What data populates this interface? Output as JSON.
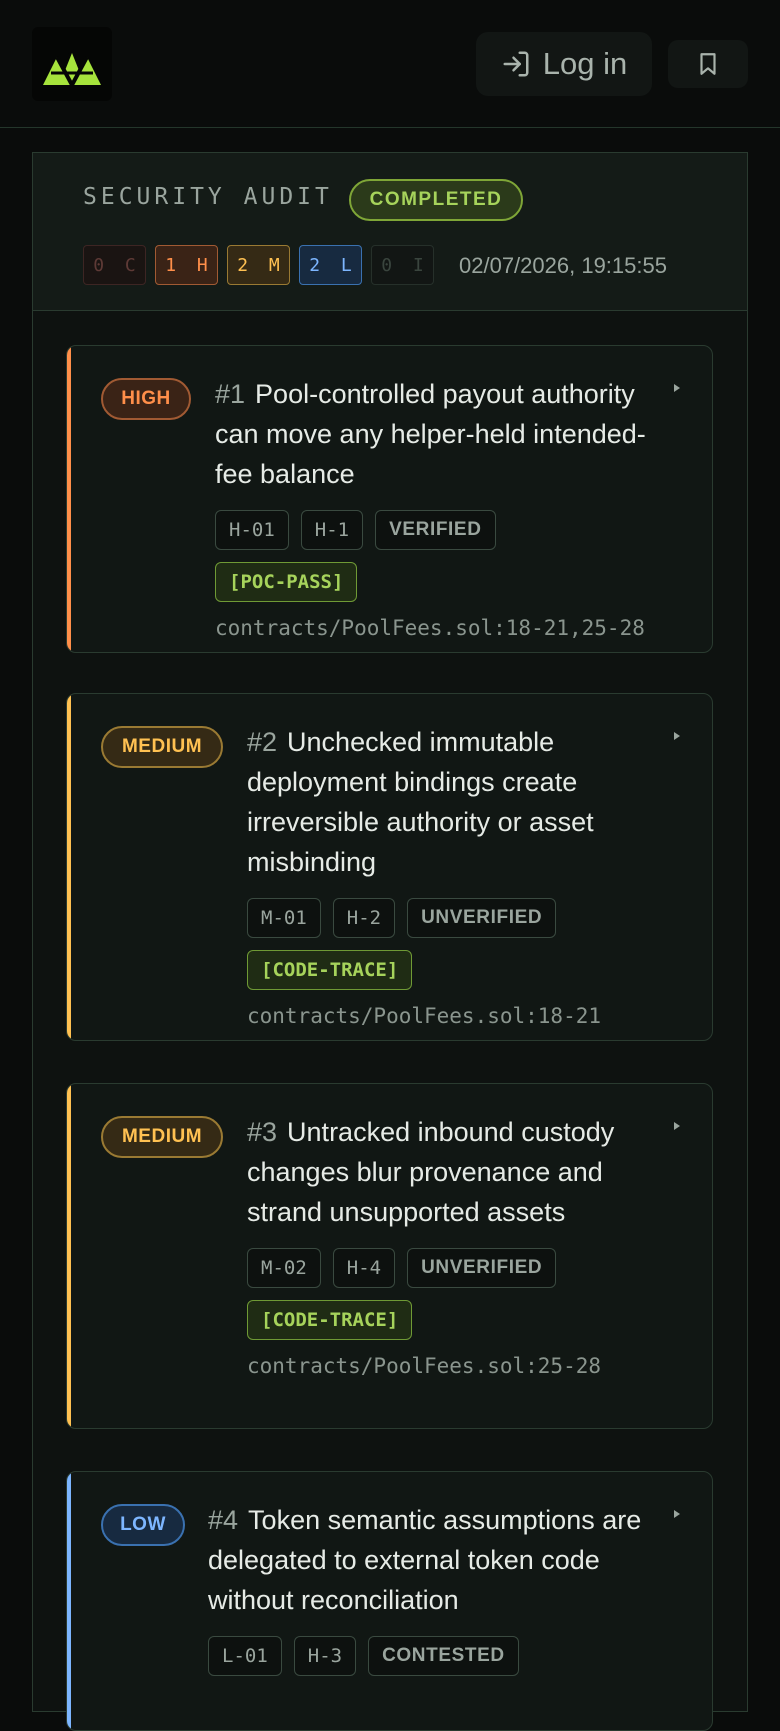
{
  "header": {
    "login_label": "Log in"
  },
  "audit": {
    "title": "SECURITY AUDIT",
    "status": "COMPLETED",
    "counts": [
      {
        "label": "0 C",
        "key": "critical"
      },
      {
        "label": "1 H",
        "key": "high"
      },
      {
        "label": "2 M",
        "key": "medium"
      },
      {
        "label": "2 L",
        "key": "low"
      },
      {
        "label": "0 I",
        "key": "info"
      }
    ],
    "timestamp": "02/07/2026, 19:15:55"
  },
  "colors": {
    "high": "#ff8f4a",
    "medium": "#ffc152",
    "low": "#7db6ff",
    "accent": "#a6d35b"
  },
  "findings": [
    {
      "severity": "HIGH",
      "number": "#1",
      "title": "Pool-controlled payout authority can move any helper-held intended-fee balance",
      "tags": [
        "H-01",
        "H-1",
        "VERIFIED"
      ],
      "method": "[POC-PASS]",
      "location": "contracts/PoolFees.sol:18-21,25-28"
    },
    {
      "severity": "MEDIUM",
      "number": "#2",
      "title": "Unchecked immutable deployment bindings create irreversible authority or asset misbinding",
      "tags": [
        "M-01",
        "H-2",
        "UNVERIFIED"
      ],
      "method": "[CODE-TRACE]",
      "location": "contracts/PoolFees.sol:18-21"
    },
    {
      "severity": "MEDIUM",
      "number": "#3",
      "title": "Untracked inbound custody changes blur provenance and strand unsupported assets",
      "tags": [
        "M-02",
        "H-4",
        "UNVERIFIED"
      ],
      "method": "[CODE-TRACE]",
      "location": "contracts/PoolFees.sol:25-28"
    },
    {
      "severity": "LOW",
      "number": "#4",
      "title": "Token semantic assumptions are delegated to external token code without reconciliation",
      "tags": [
        "L-01",
        "H-3",
        "CONTESTED"
      ]
    }
  ]
}
